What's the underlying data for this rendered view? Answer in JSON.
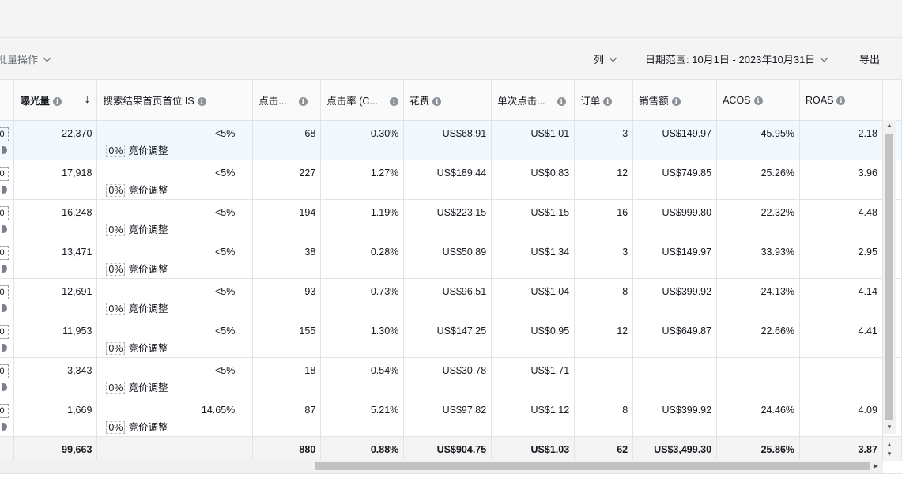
{
  "toolbar": {
    "bulk_label": "批量操作",
    "columns_label": "列",
    "date_range_label": "日期范围: 10月1日 - 2023年10月31日",
    "export_label": "导出"
  },
  "columns": {
    "impressions": "曝光量",
    "top_of_search_is": "搜索结果首页首位 IS",
    "clicks": "点击...",
    "ctr": "点击率 (C...",
    "spend": "花费",
    "cpc": "单次点击...",
    "orders": "订单",
    "sales": "销售额",
    "acos": "ACOS",
    "roas": "ROAS"
  },
  "edge_text": "0",
  "bid_adjust_label": "竞价调整",
  "rows": [
    {
      "impressions": "22,370",
      "is": "<5%",
      "bid_pct": "0%",
      "clicks": "68",
      "ctr": "0.30%",
      "spend": "US$68.91",
      "cpc": "US$1.01",
      "orders": "3",
      "sales": "US$149.97",
      "acos": "45.95%",
      "roas": "2.18"
    },
    {
      "impressions": "17,918",
      "is": "<5%",
      "bid_pct": "0%",
      "clicks": "227",
      "ctr": "1.27%",
      "spend": "US$189.44",
      "cpc": "US$0.83",
      "orders": "12",
      "sales": "US$749.85",
      "acos": "25.26%",
      "roas": "3.96"
    },
    {
      "impressions": "16,248",
      "is": "<5%",
      "bid_pct": "0%",
      "clicks": "194",
      "ctr": "1.19%",
      "spend": "US$223.15",
      "cpc": "US$1.15",
      "orders": "16",
      "sales": "US$999.80",
      "acos": "22.32%",
      "roas": "4.48"
    },
    {
      "impressions": "13,471",
      "is": "<5%",
      "bid_pct": "0%",
      "clicks": "38",
      "ctr": "0.28%",
      "spend": "US$50.89",
      "cpc": "US$1.34",
      "orders": "3",
      "sales": "US$149.97",
      "acos": "33.93%",
      "roas": "2.95"
    },
    {
      "impressions": "12,691",
      "is": "<5%",
      "bid_pct": "0%",
      "clicks": "93",
      "ctr": "0.73%",
      "spend": "US$96.51",
      "cpc": "US$1.04",
      "orders": "8",
      "sales": "US$399.92",
      "acos": "24.13%",
      "roas": "4.14"
    },
    {
      "impressions": "11,953",
      "is": "<5%",
      "bid_pct": "0%",
      "clicks": "155",
      "ctr": "1.30%",
      "spend": "US$147.25",
      "cpc": "US$0.95",
      "orders": "12",
      "sales": "US$649.87",
      "acos": "22.66%",
      "roas": "4.41"
    },
    {
      "impressions": "3,343",
      "is": "<5%",
      "bid_pct": "0%",
      "clicks": "18",
      "ctr": "0.54%",
      "spend": "US$30.78",
      "cpc": "US$1.71",
      "orders": "—",
      "sales": "—",
      "acos": "—",
      "roas": "—"
    },
    {
      "impressions": "1,669",
      "is": "14.65%",
      "bid_pct": "0%",
      "clicks": "87",
      "ctr": "5.21%",
      "spend": "US$97.82",
      "cpc": "US$1.12",
      "orders": "8",
      "sales": "US$399.92",
      "acos": "24.46%",
      "roas": "4.09"
    }
  ],
  "totals": {
    "impressions": "99,663",
    "clicks": "880",
    "ctr": "0.88%",
    "spend": "US$904.75",
    "cpc": "US$1.03",
    "orders": "62",
    "sales": "US$3,499.30",
    "acos": "25.86%",
    "roas": "3.87"
  }
}
